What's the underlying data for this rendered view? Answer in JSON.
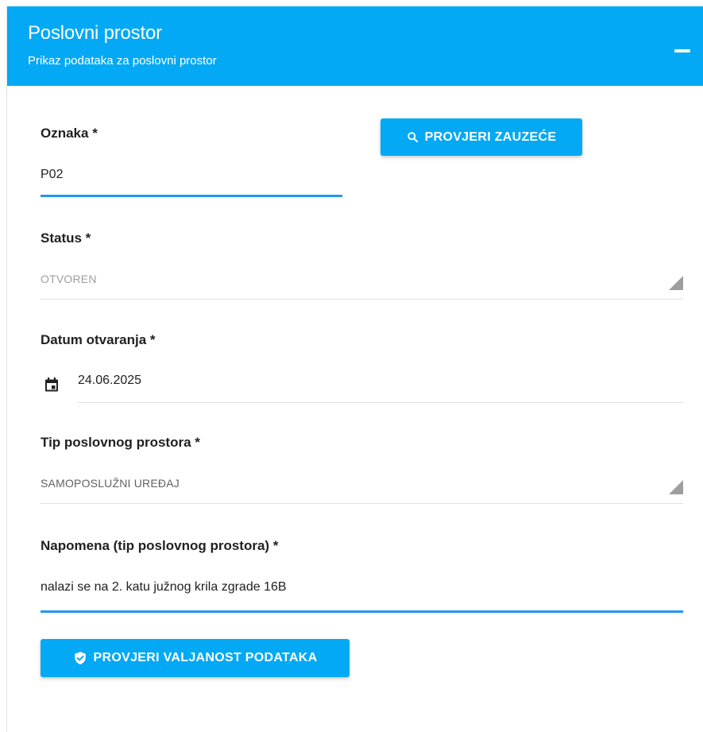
{
  "header": {
    "title": "Poslovni prostor",
    "subtitle": "Prikaz podataka za poslovni prostor",
    "collapse_icon": "minus-icon"
  },
  "form": {
    "oznaka": {
      "label": "Oznaka *",
      "value": "P02"
    },
    "check_occupancy_button": {
      "label": "PROVJERI ZAUZEĆE",
      "icon": "search-icon"
    },
    "status": {
      "label": "Status *",
      "value": "OTVOREN",
      "icon": "dropdown-arrow-icon"
    },
    "datum": {
      "label": "Datum otvaranja *",
      "value": "24.06.2025",
      "icon": "calendar-icon"
    },
    "tip": {
      "label": "Tip poslovnog prostora *",
      "value": "SAMOPOSLUŽNI UREĐAJ",
      "icon": "dropdown-arrow-icon"
    },
    "napomena": {
      "label": "Napomena (tip poslovnog prostora) *",
      "value": "nalazi se na 2. katu južnog krila zgrade 16B"
    },
    "validate_button": {
      "label": "PROVJERI VALJANOST PODATAKA",
      "icon": "shield-check-icon"
    }
  },
  "colors": {
    "accent": "#03a9f4",
    "focus_underline": "#2196f3"
  }
}
